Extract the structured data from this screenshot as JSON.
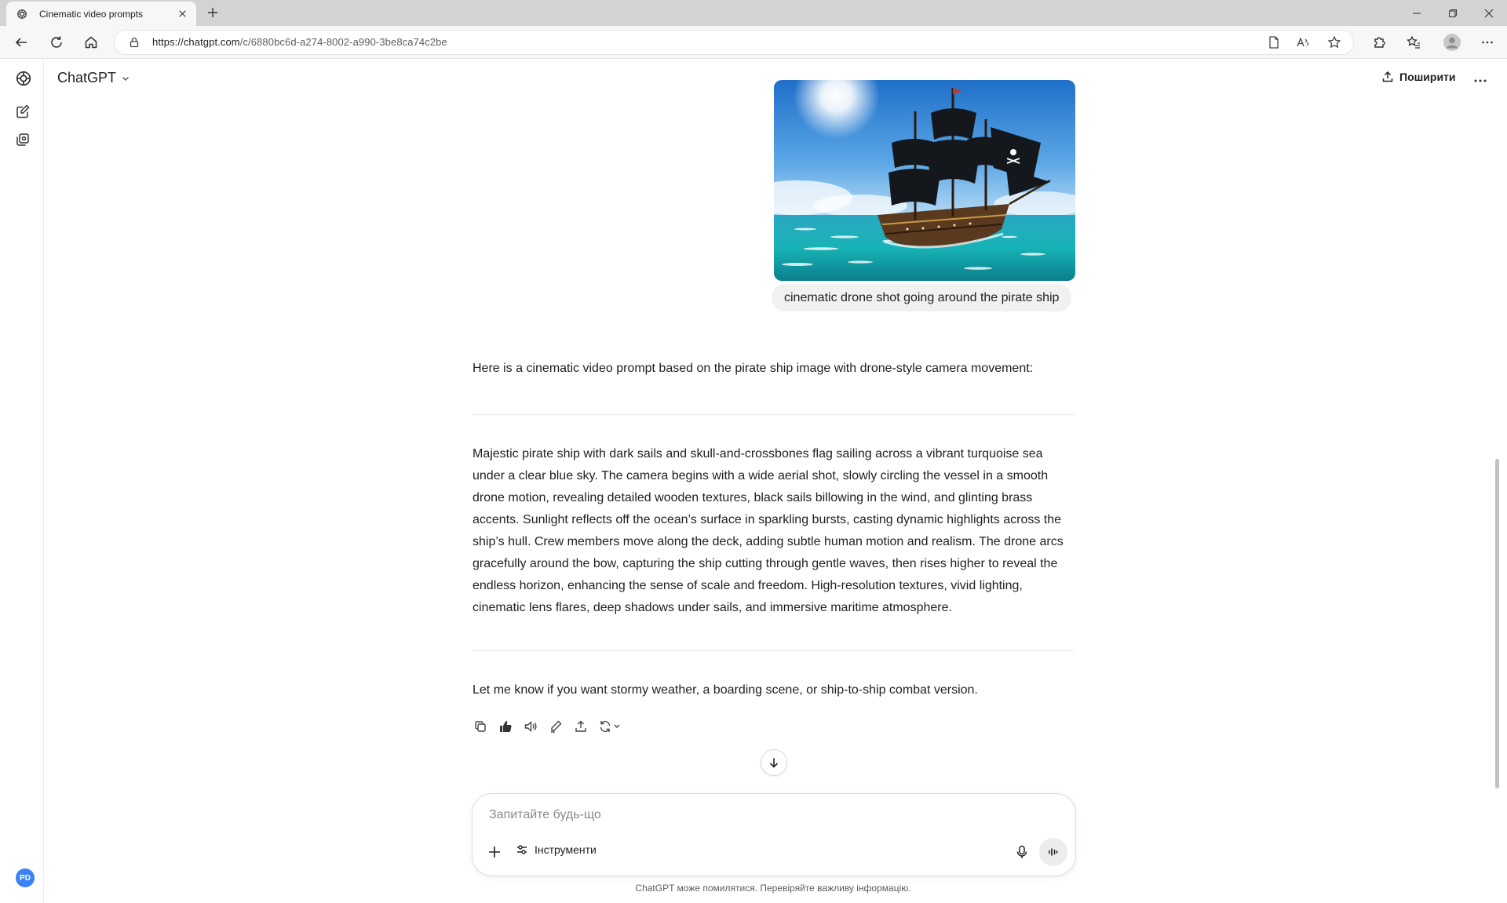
{
  "browser": {
    "tab_title": "Cinematic video prompts",
    "url_host": "https://chatgpt.com",
    "url_path": "/c/6880bc6d-a274-8002-a990-3be8ca74c2be"
  },
  "header": {
    "model": "ChatGPT",
    "share_label": "Поширити"
  },
  "sidebar": {
    "avatar_initials": "PD"
  },
  "conversation": {
    "user_message": "cinematic drone shot going around the pirate ship",
    "reply_intro": "Here is a cinematic video prompt based on the pirate ship image with drone-style camera movement:",
    "reply_prompt": "Majestic pirate ship with dark sails and skull-and-crossbones flag sailing across a vibrant turquoise sea under a clear blue sky. The camera begins with a wide aerial shot, slowly circling the vessel in a smooth drone motion, revealing detailed wooden textures, black sails billowing in the wind, and glinting brass accents. Sunlight reflects off the ocean’s surface in sparkling bursts, casting dynamic highlights across the ship’s hull. Crew members move along the deck, adding subtle human motion and realism. The drone arcs gracefully around the bow, capturing the ship cutting through gentle waves, then rises higher to reveal the endless horizon, enhancing the sense of scale and freedom. High-resolution textures, vivid lighting, cinematic lens flares, deep shadows under sails, and immersive maritime atmosphere.",
    "reply_outro": "Let me know if you want stormy weather, a boarding scene, or ship-to-ship combat version."
  },
  "composer": {
    "placeholder": "Запитайте будь-що",
    "tools_label": "Інструменти"
  },
  "footer": {
    "disclaimer": "ChatGPT може помилятися. Перевіряйте важливу інформацію."
  },
  "colors": {
    "tabbar": "#d3d3d3",
    "toolbar": "#f7f7f7",
    "user_bubble": "#f1f1f1",
    "avatar": "#3b82f6"
  }
}
